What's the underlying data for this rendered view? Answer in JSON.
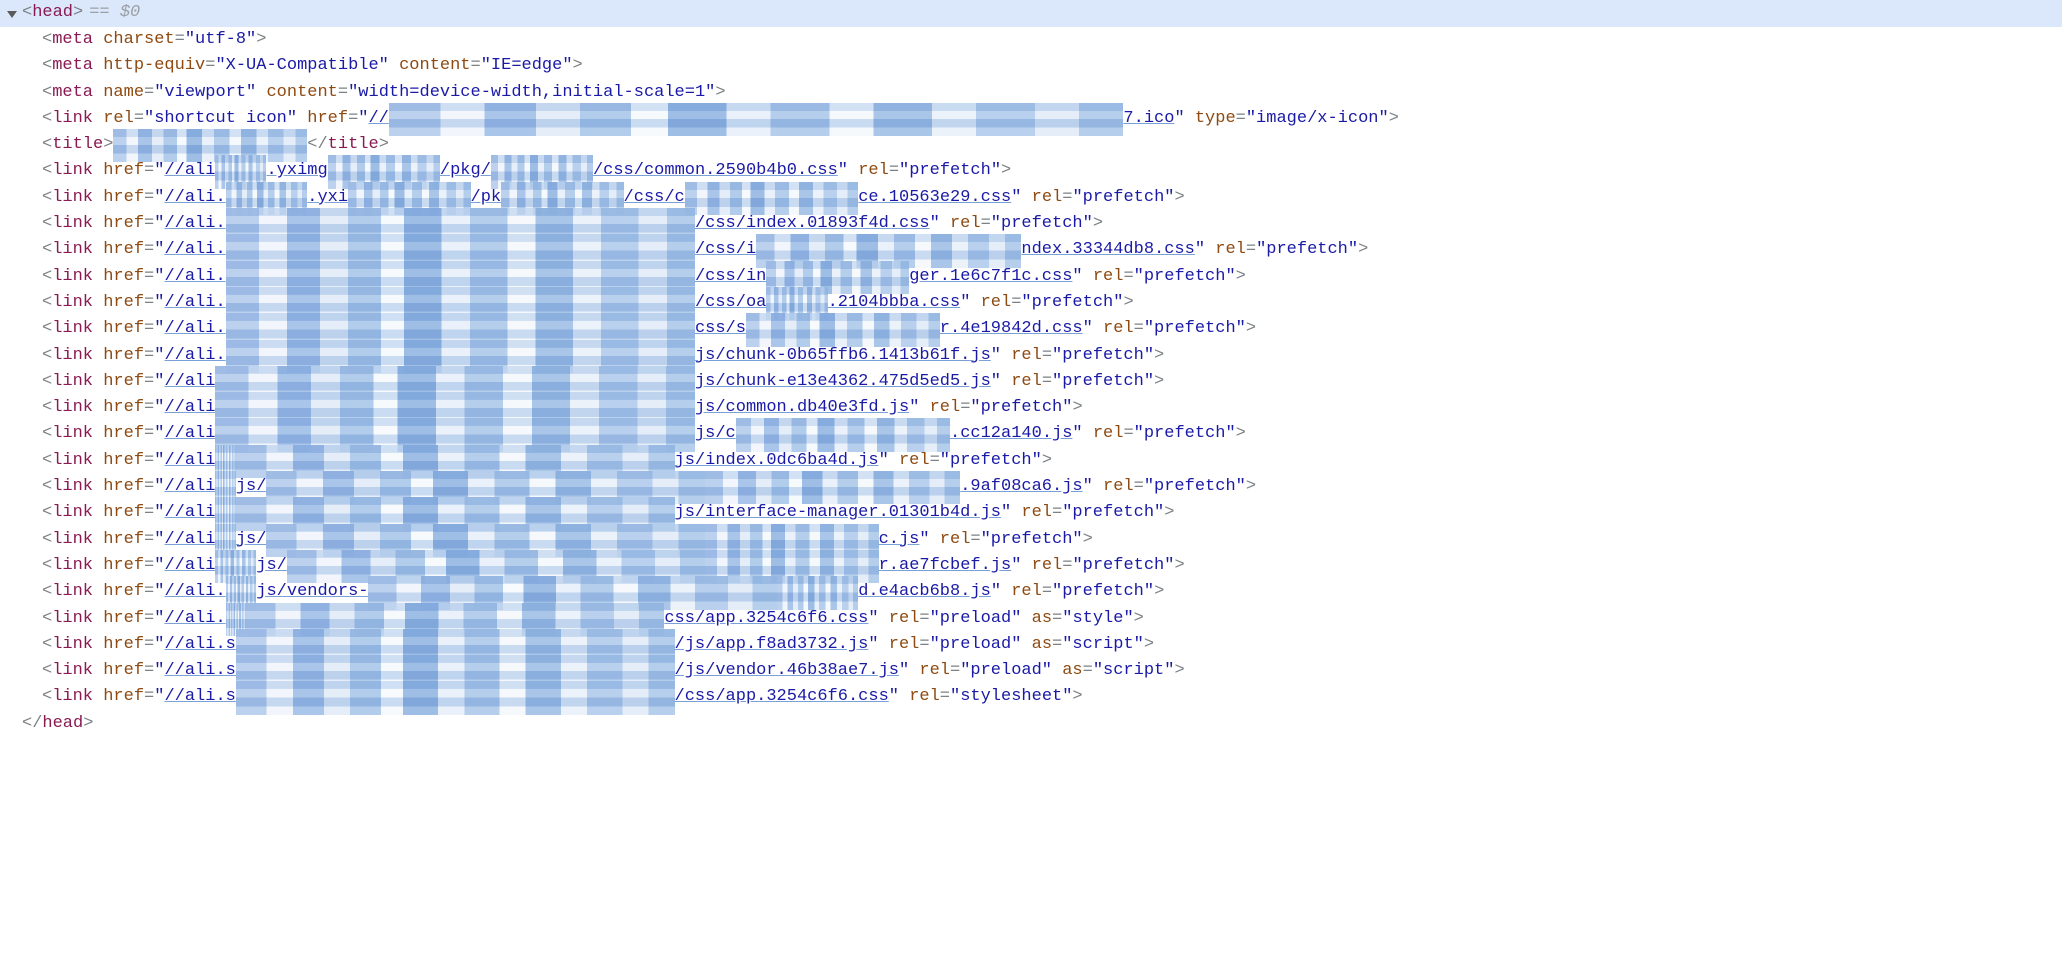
{
  "selected": {
    "tag": "head",
    "suffix": " == $0"
  },
  "metas": [
    {
      "attrs": [
        [
          "charset",
          "utf-8"
        ]
      ]
    },
    {
      "attrs": [
        [
          "http-equiv",
          "X-UA-Compatible"
        ],
        [
          "content",
          "IE=edge"
        ]
      ]
    },
    {
      "attrs": [
        [
          "name",
          "viewport"
        ],
        [
          "content",
          "width=device-width,initial-scale=1"
        ]
      ]
    }
  ],
  "favicon": {
    "rel": "shortcut icon",
    "href_prefix": "//",
    "href_censored": "xxxxxxxxxxxxxxxxxxxxxxxxxxxxxxxxxxxxxxxxxxxxxxxxxxxxxxxxxxxxxxxxxxxxxxxx",
    "href_suffix": "7.ico",
    "type": "image/x-icon"
  },
  "title": {
    "censored": "xxxxxxxxxxxxxxxxxxx"
  },
  "links": [
    {
      "pre": "//ali",
      "cen": "xxxxx",
      "mid": ".yximg",
      "cen2": "xxxxxxxxxxx",
      "mid2": "/pkg/",
      "cen3": "xxxxxxxxxx",
      "tail": "/css/common.2590b4b0.css",
      "rel": "prefetch"
    },
    {
      "pre": "//ali.",
      "cen": "xxxxxxxx",
      "mid": ".yxi",
      "cen2": "xxxxxxxxxxxx",
      "mid2": "/pk",
      "cen3": "xxxxxxxxxxxx",
      "tail": "/css/c",
      "post_cen": "xxxxxxxxxxxxxxxxx",
      "post": "ce.10563e29.css",
      "rel": "prefetch"
    },
    {
      "pre": "//ali.",
      "cen": "xxxxxxxxxxxxxxxxxxxxxxxxxxxxxxxxxxxxxxxxxxxxxx",
      "tail": "/css/index.01893f4d.css",
      "rel": "prefetch"
    },
    {
      "pre": "//ali.",
      "cen": "xxxxxxxxxxxxxxxxxxxxxxxxxxxxxxxxxxxxxxxxxxxxxx",
      "mid": "/css/i",
      "post_cen": "xxxxxxxxxxxxxxxxxxxxxxxxxx",
      "post": "ndex.33344db8.css",
      "rel": "prefetch"
    },
    {
      "pre": "//ali.",
      "cen": "xxxxxxxxxxxxxxxxxxxxxxxxxxxxxxxxxxxxxxxxxxxxxx",
      "mid": "/css/in",
      "post_cen": "xxxxxxxxxxxxxx",
      "post": "ger.1e6c7f1c.css",
      "rel": "prefetch"
    },
    {
      "pre": "//ali.",
      "cen": "xxxxxxxxxxxxxxxxxxxxxxxxxxxxxxxxxxxxxxxxxxxxxx",
      "mid": "/css/oa",
      "post_cen": "xxxxxx",
      "post": ".2104bbba.css",
      "rel": "prefetch"
    },
    {
      "pre": "//ali.",
      "cen": "xxxxxxxxxxxxxxxxxxxxxxxxxxxxxxxxxxxxxxxxxxxxxx",
      "mid": "css/s",
      "post_cen": "xxxxxxxxxxxxxxxxxxx",
      "post": "r.4e19842d.css",
      "rel": "prefetch"
    },
    {
      "pre": "//ali.",
      "cen": "xxxxxxxxxxxxxxxxxxxxxxxxxxxxxxxxxxxxxxxxxxxxxx",
      "tail": "js/chunk-0b65ffb6.1413b61f.js",
      "rel": "prefetch"
    },
    {
      "pre": "//ali",
      "cen": "xxxxxxxxxxxxxxxxxxxxxxxxxxxxxxxxxxxxxxxxxxxxxxx",
      "tail": "js/chunk-e13e4362.475d5ed5.js",
      "rel": "prefetch"
    },
    {
      "pre": "//ali",
      "cen": "xxxxxxxxxxxxxxxxxxxxxxxxxxxxxxxxxxxxxxxxxxxxxxx",
      "tail": "js/common.db40e3fd.js",
      "rel": "prefetch"
    },
    {
      "pre": "//ali",
      "cen": "xxxxxxxxxxxxxxxxxxxxxxxxxxxxxxxxxxxxxxxxxxxxxxx",
      "mid": "js/c",
      "post_cen": "xxxxxxxxxxxxxxxxxxxxx",
      "post": ".cc12a140.js",
      "rel": "prefetch"
    },
    {
      "pre": "//ali",
      "cen": "tx",
      "mid2": "",
      "cen2": "xxxxxxxxxxxxxxxxxxxxxxxxxxxxxxxxxxxxxxxxxxx",
      "tail": "js/index.0dc6ba4d.js",
      "rel": "prefetch"
    },
    {
      "pre": "//ali",
      "cen": "tx",
      "cen2": "xxxxxxxxxxxxxxxxxxxxxxxxxxxxxxxxxxxxxxxxxxx",
      "mid": "js/",
      "post_cen": "xxxxxxxxxxxxxxxxxxxxxxxxx",
      "post": ".9af08ca6.js",
      "rel": "prefetch"
    },
    {
      "pre": "//ali",
      "cen": "tx",
      "cen2": "xxxxxxxxxxxxxxxxxxxxxxxxxxxxxxxxxxxxxxxxxxx",
      "tail": "js/interface-manager.01301b4d.js",
      "rel": "prefetch"
    },
    {
      "pre": "//ali",
      "cen": "tx",
      "cen2": "xxxxxxxxxxxxxxxxxxxxxxxxxxxxxxxxxxxxxxxxxxx",
      "mid": "js/",
      "post_cen": "xxxxxxxxxxxxxxxxx",
      "post": "c.js",
      "rel": "prefetch"
    },
    {
      "pre": "//ali",
      "cen": "xtat",
      "cen2": "xxxxxxxxxxxxxxxxxxxxxxxxxxxxxxxxxxxxxxxxx",
      "mid": "js/",
      "post_cen": "xxxxxxxxxxxxxxxxx",
      "post": "r.ae7fcbef.js",
      "rel": "prefetch"
    },
    {
      "pre": "//ali.",
      "cen": "xtx",
      "cen2": "xxxxxxxxxxxxxxxxxxxxxxxxxxxxxxxxxxxxxxxx",
      "mid": "js/vendors-",
      "post_cen": "xxxxxxxx",
      "post": "d.e4acb6b8.js",
      "rel": "prefetch"
    },
    {
      "pre": "//ali.",
      "cen": "xx",
      "cen2": "xxxxxxxxxxxxxxxxxxxxxxxxxxxxxxxxxxxxxxxxx",
      "tail": "css/app.3254c6f6.css",
      "rel": "preload",
      "as": "style"
    },
    {
      "pre": "//ali.s",
      "cen": "xxxxxxxxxxxxxxxxxxxxxxxxxxxxxxxxxxxxxxxxxxx",
      "tail": "/js/app.f8ad3732.js",
      "rel": "preload",
      "as": "script"
    },
    {
      "pre": "//ali.s",
      "cen": "xxxxxxxxxxxxxxxxxxxxxxxxxxxxxxxxxxxxxxxxxxx",
      "tail": "/js/vendor.46b38ae7.js",
      "rel": "preload",
      "as": "script"
    },
    {
      "pre": "//ali.s",
      "cen": "xxxxxxxxxxxxxxxxxxxxxxxxxxxxxxxxxxxxxxxxxxx",
      "tail": "/css/app.3254c6f6.css",
      "rel": "stylesheet"
    }
  ],
  "close_tag": "head"
}
